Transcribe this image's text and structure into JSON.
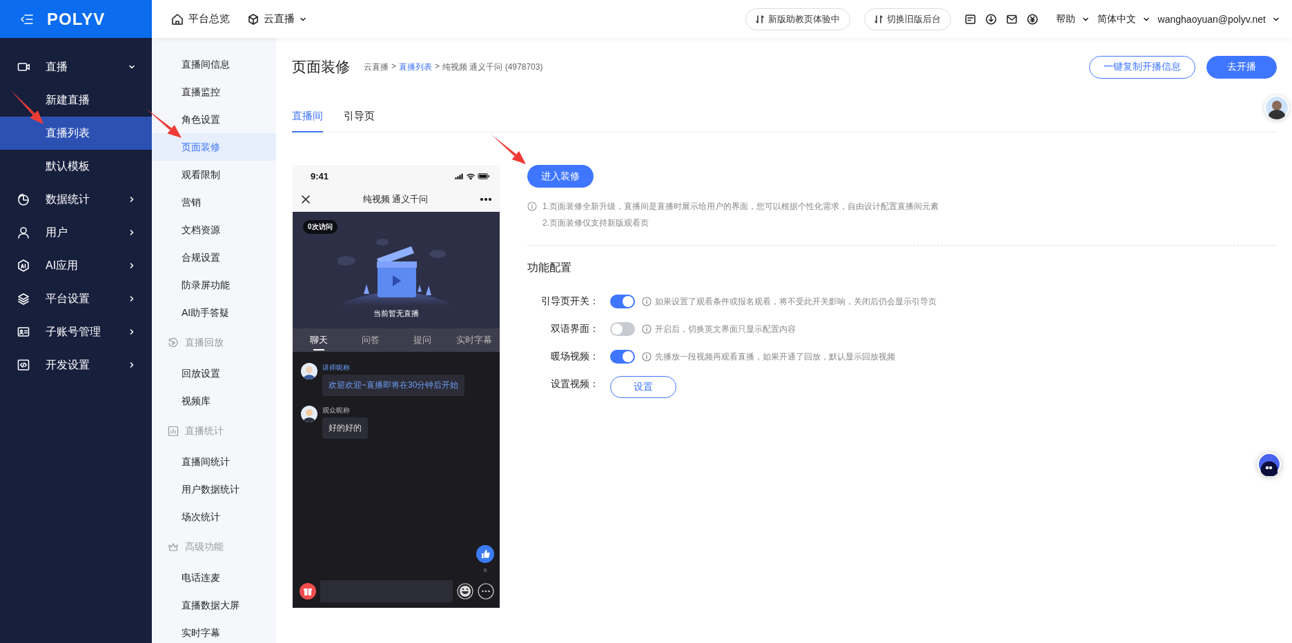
{
  "topbar": {
    "logo": "POLYV",
    "nav": [
      {
        "label": "平台总览",
        "dropdown": false
      },
      {
        "label": "云直播",
        "dropdown": true
      }
    ],
    "buttons": [
      "新版助教页体验中",
      "切换旧版后台"
    ],
    "menus": [
      "帮助",
      "简体中文",
      "wanghaoyuan@polyv.net"
    ]
  },
  "sidebar": {
    "items": [
      {
        "label": "直播",
        "expanded": true,
        "children": [
          {
            "label": "新建直播",
            "selected": false
          },
          {
            "label": "直播列表",
            "selected": true
          },
          {
            "label": "默认模板",
            "selected": false
          }
        ]
      },
      {
        "label": "数据统计",
        "expanded": false
      },
      {
        "label": "用户",
        "expanded": false
      },
      {
        "label": "AI应用",
        "expanded": false
      },
      {
        "label": "平台设置",
        "expanded": false
      },
      {
        "label": "子账号管理",
        "expanded": false
      },
      {
        "label": "开发设置",
        "expanded": false
      }
    ]
  },
  "subnav": {
    "groups": [
      {
        "items": [
          {
            "label": "直播间信息",
            "selected": false
          },
          {
            "label": "直播监控",
            "selected": false
          },
          {
            "label": "角色设置",
            "selected": false
          },
          {
            "label": "页面装修",
            "selected": true
          },
          {
            "label": "观看限制",
            "selected": false
          },
          {
            "label": "营销",
            "selected": false
          },
          {
            "label": "文档资源",
            "selected": false
          },
          {
            "label": "合规设置",
            "selected": false
          },
          {
            "label": "防录屏功能",
            "selected": false
          },
          {
            "label": "AI助手答疑",
            "selected": false
          }
        ]
      },
      {
        "title": "直播回放",
        "items": [
          {
            "label": "回放设置",
            "selected": false
          },
          {
            "label": "视频库",
            "selected": false
          }
        ]
      },
      {
        "title": "直播统计",
        "items": [
          {
            "label": "直播间统计",
            "selected": false
          },
          {
            "label": "用户数据统计",
            "selected": false
          },
          {
            "label": "场次统计",
            "selected": false
          }
        ]
      },
      {
        "title": "高级功能",
        "items": [
          {
            "label": "电话连麦",
            "selected": false
          },
          {
            "label": "直播数据大屏",
            "selected": false
          },
          {
            "label": "实时字幕",
            "selected": false
          }
        ]
      }
    ]
  },
  "page": {
    "title": "页面装修",
    "breadcrumb": [
      {
        "kind": "text",
        "text": "云直播"
      },
      {
        "kind": "sep",
        "text": ">"
      },
      {
        "kind": "link",
        "text": "直播列表"
      },
      {
        "kind": "sep",
        "text": ">"
      },
      {
        "kind": "text",
        "text": "纯视频 通义千问 (4978703)"
      }
    ],
    "actions": [
      {
        "label": "一键复制开播信息",
        "primary": false
      },
      {
        "label": "去开播",
        "primary": true
      }
    ],
    "tabs": [
      {
        "label": "直播间",
        "selected": true
      },
      {
        "label": "引导页",
        "selected": false
      }
    ]
  },
  "phone": {
    "time": "9:41",
    "title": "纯视频 通义千问",
    "visits": "0次访问",
    "status": "当前暂无直播",
    "tabs": [
      {
        "label": "聊天",
        "selected": true
      },
      {
        "label": "问答",
        "selected": false
      },
      {
        "label": "提问",
        "selected": false
      },
      {
        "label": "实时字幕",
        "selected": false
      }
    ],
    "messages": [
      {
        "kind": "teacher",
        "nickname": "讲师昵称",
        "text": "欢迎欢迎~直播即将在30分钟后开始"
      },
      {
        "kind": "viewer",
        "nickname": "观众昵称",
        "text": "好的好的"
      }
    ],
    "likes": "0"
  },
  "decoration": {
    "button": "进入装修",
    "notes": [
      "1.页面装修全新升级，直播间是直播时展示给用户的界面，您可以根据个性化需求，自由设计配置直播间元素",
      "2.页面装修仅支持新版观看页"
    ],
    "section_title": "功能配置",
    "settings": [
      {
        "kind": "switch",
        "label": "引导页开关：",
        "on": true,
        "hint": "如果设置了观看条件或报名观看，将不受此开关影响，关闭后仍会显示引导页"
      },
      {
        "kind": "switch",
        "label": "双语界面：",
        "on": false,
        "hint": "开启后，切换英文界面只显示配置内容"
      },
      {
        "kind": "switch",
        "label": "暖场视频：",
        "on": true,
        "hint": "先播放一段视频再观看直播，如果开通了回放，默认显示回放视频"
      },
      {
        "kind": "button",
        "label": "设置视频：",
        "button": "设置"
      }
    ]
  }
}
